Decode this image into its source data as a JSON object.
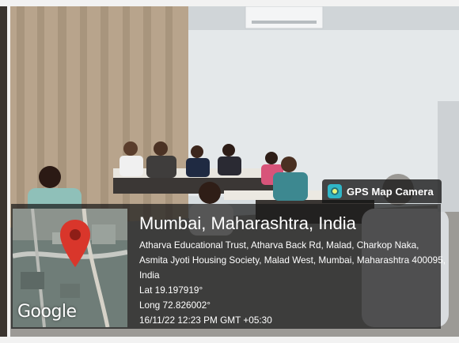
{
  "badge": {
    "label": "GPS Map Camera",
    "icon": "gps-camera-app-icon"
  },
  "location": {
    "city": "Mumbai, Maharashtra, India",
    "address": "Atharva Educational Trust, Atharva Back Rd, Malad, Charkop Naka, Asmita Jyoti Housing Society, Malad West, Mumbai, Maharashtra 400095, India",
    "lat": "Lat 19.197919°",
    "long": "Long 72.826002°",
    "timestamp": "16/11/22 12:23 PM GMT +05:30"
  },
  "map": {
    "brand": "Google",
    "pin_color": "#d9362b"
  }
}
